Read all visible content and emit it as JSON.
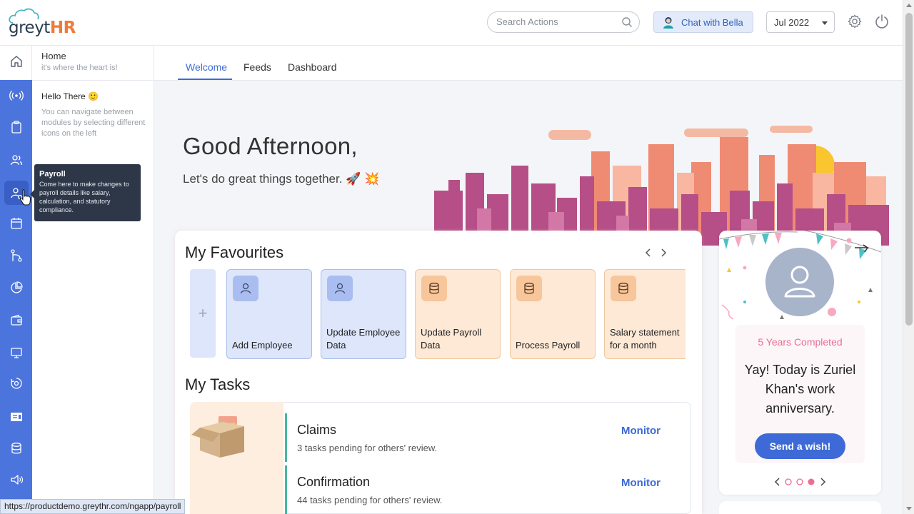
{
  "header": {
    "logo": {
      "grey": "greyt",
      "hr": "HR"
    },
    "search": {
      "placeholder": "Search Actions"
    },
    "chat_label": "Chat with Bella",
    "month_value": "Jul 2022"
  },
  "sidebar": {
    "home": {
      "title": "Home",
      "subtitle": "it's where the heart is!"
    },
    "hello": {
      "title": "Hello There 🙂",
      "desc": "You can navigate between modules by selecting different icons on the left"
    },
    "items": [
      "home-icon",
      "broadcast-icon",
      "clipboard-icon",
      "users-icon",
      "payroll-icon",
      "calendar-icon",
      "workflow-icon",
      "pie-chart-icon",
      "wallet-icon",
      "monitor-icon",
      "settings-sync-icon",
      "reports-icon",
      "database-icon",
      "announce-icon"
    ]
  },
  "tooltip": {
    "title": "Payroll",
    "body": "Come here to make changes to payroll details like salary, calculation, and statutory compliance."
  },
  "tabs": [
    {
      "label": "Welcome",
      "active": true
    },
    {
      "label": "Feeds",
      "active": false
    },
    {
      "label": "Dashboard",
      "active": false
    }
  ],
  "greeting": {
    "title": "Good Afternoon,",
    "subtitle": "Let's do great things together. 🚀 💥"
  },
  "favourites": {
    "title": "My Favourites",
    "add_symbol": "+",
    "tiles": [
      {
        "label": "Add Employee",
        "variant": "blue",
        "icon": "user-icon"
      },
      {
        "label": "Update Employee Data",
        "variant": "blue",
        "icon": "user-icon"
      },
      {
        "label": "Update Payroll Data",
        "variant": "peach",
        "icon": "database-icon"
      },
      {
        "label": "Process Payroll",
        "variant": "peach",
        "icon": "database-icon"
      },
      {
        "label": "Salary statement for a month",
        "variant": "peach",
        "icon": "database-icon"
      }
    ]
  },
  "tasks": {
    "title": "My Tasks",
    "items": [
      {
        "name": "Claims",
        "desc": "3 tasks pending for others' review.",
        "action": "Monitor"
      },
      {
        "name": "Confirmation",
        "desc": "44 tasks pending for others' review.",
        "action": "Monitor"
      }
    ]
  },
  "anniversary": {
    "years": "5 Years Completed",
    "message": "Yay! Today is Zuriel Khan's work anniversary.",
    "button": "Send a wish!",
    "pages": 3,
    "active_page": 3
  },
  "status_url": "https://productdemo.greythr.com/ngapp/payroll",
  "colors": {
    "primary": "#3d6ad6",
    "rail": "#4b74dd",
    "accent": "#ee7b38",
    "anniversary": "#ec6d93",
    "task_bar": "#47b89f"
  }
}
